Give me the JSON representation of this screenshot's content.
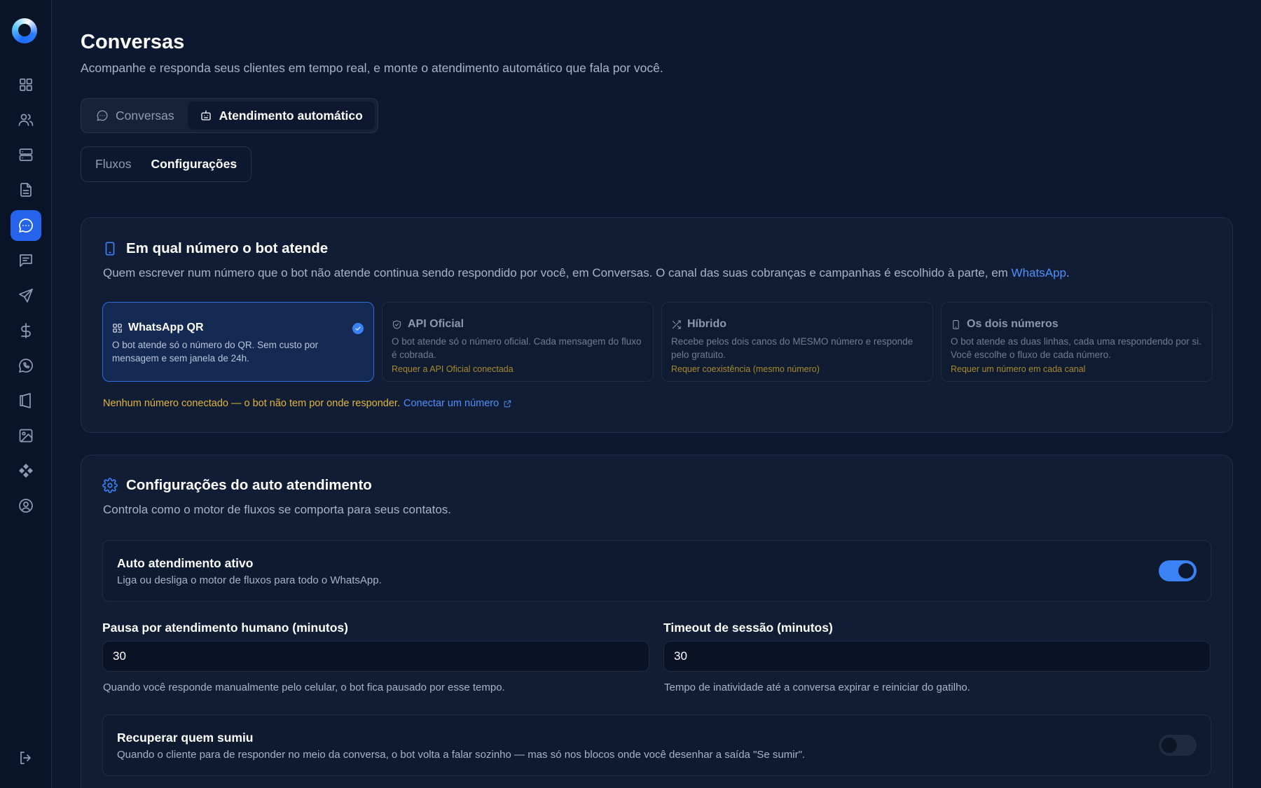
{
  "page": {
    "title": "Conversas",
    "subtitle": "Acompanhe e responda seus clientes em tempo real, e monte o atendimento automático que fala por você."
  },
  "tabs": [
    {
      "label": "Conversas",
      "icon": "chat-icon",
      "active": false
    },
    {
      "label": "Atendimento automático",
      "icon": "bot-icon",
      "active": true
    }
  ],
  "subtabs": [
    {
      "label": "Fluxos",
      "active": false
    },
    {
      "label": "Configurações",
      "active": true
    }
  ],
  "number_card": {
    "title": "Em qual número o bot atende",
    "description": "Quem escrever num número que o bot não atende continua sendo respondido por você, em Conversas. O canal das suas cobranças e campanhas é escolhido à parte, em ",
    "description_link": "WhatsApp",
    "description_end": ".",
    "options": [
      {
        "title": "WhatsApp QR",
        "description": "O bot atende só o número do QR. Sem custo por mensagem e sem janela de 24h.",
        "requirement": "",
        "selected": true
      },
      {
        "title": "API Oficial",
        "description": "O bot atende só o número oficial. Cada mensagem do fluxo é cobrada.",
        "requirement": "Requer a API Oficial conectada",
        "selected": false
      },
      {
        "title": "Híbrido",
        "description": "Recebe pelos dois canos do MESMO número e responde pelo gratuito.",
        "requirement": "Requer coexistência (mesmo número)",
        "selected": false
      },
      {
        "title": "Os dois números",
        "description": "O bot atende as duas linhas, cada uma respondendo por si. Você escolhe o fluxo de cada número.",
        "requirement": "Requer um número em cada canal",
        "selected": false
      }
    ],
    "warning": "Nenhum número conectado — o bot não tem por onde responder.",
    "warning_link": "Conectar um número"
  },
  "settings_card": {
    "title": "Configurações do auto atendimento",
    "description": "Controla como o motor de fluxos se comporta para seus contatos.",
    "auto_toggle": {
      "title": "Auto atendimento ativo",
      "description": "Liga ou desliga o motor de fluxos para todo o WhatsApp.",
      "on": true
    },
    "pause_field": {
      "label": "Pausa por atendimento humano (minutos)",
      "value": "30",
      "help": "Quando você responde manualmente pelo celular, o bot fica pausado por esse tempo."
    },
    "timeout_field": {
      "label": "Timeout de sessão (minutos)",
      "value": "30",
      "help": "Tempo de inatividade até a conversa expirar e reiniciar do gatilho."
    },
    "recover_toggle": {
      "title": "Recuperar quem sumiu",
      "description": "Quando o cliente para de responder no meio da conversa, o bot volta a falar sozinho — mas só nos blocos onde você desenhar a saída \"Se sumir\".",
      "on": false
    }
  },
  "colors": {
    "accent": "#3b82f6",
    "warning": "#e0b53a",
    "background": "#0c1830"
  }
}
